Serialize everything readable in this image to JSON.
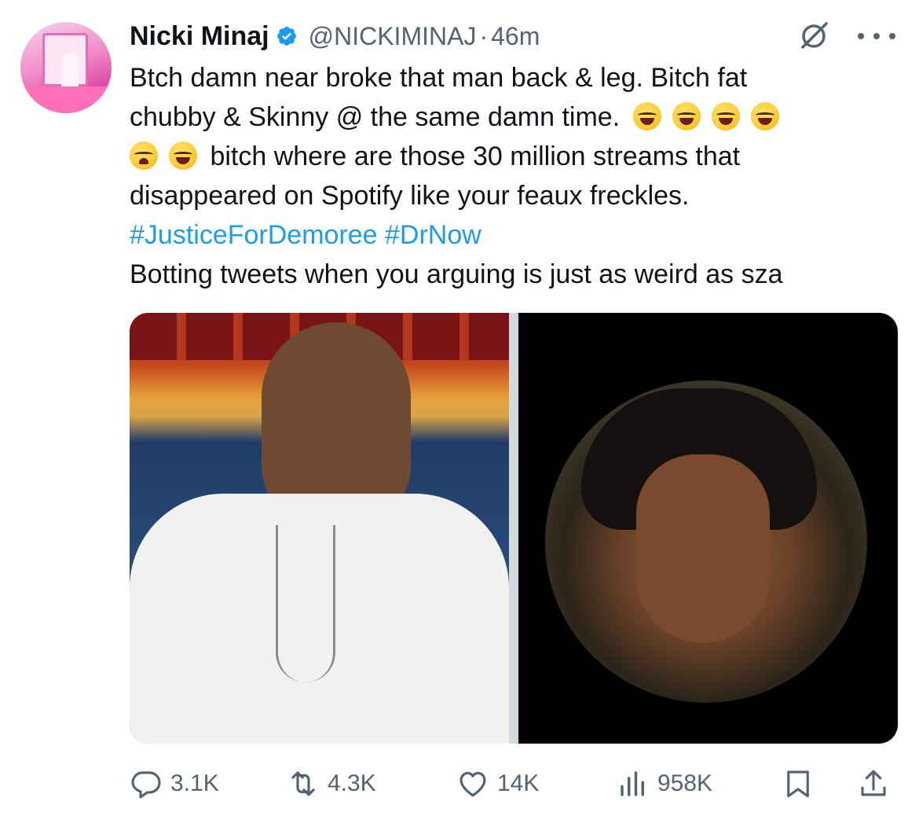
{
  "tweet": {
    "author_name": "Nicki Minaj",
    "handle": "@NICKIMINAJ",
    "separator": "·",
    "time": "46m",
    "lines": [
      "Btch damn near broke that man back & leg. Bitch fat",
      "chubby & Skinny @ the same damn time.",
      "bitch where are those 30 million streams that",
      "disappeared on Spotify like your feaux freckles."
    ],
    "hashtags": [
      "#JusticeForDemoree",
      "#DrNow"
    ],
    "caption": "Botting tweets when you arguing is just as weird as sza"
  },
  "actions": {
    "replies": "3.1K",
    "reposts": "4.3K",
    "likes": "14K",
    "views": "958K"
  },
  "icons": {
    "verified": "verified-badge-icon",
    "grok": "grok-icon",
    "more": "more-icon",
    "reply": "reply-icon",
    "repost": "repost-icon",
    "like": "heart-icon",
    "views": "views-chart-icon",
    "bookmark": "bookmark-icon",
    "share": "share-icon"
  },
  "colors": {
    "text": "#0f1419",
    "secondary": "#536471",
    "link": "#1d9bf0",
    "verified": "#1d9bf0"
  }
}
